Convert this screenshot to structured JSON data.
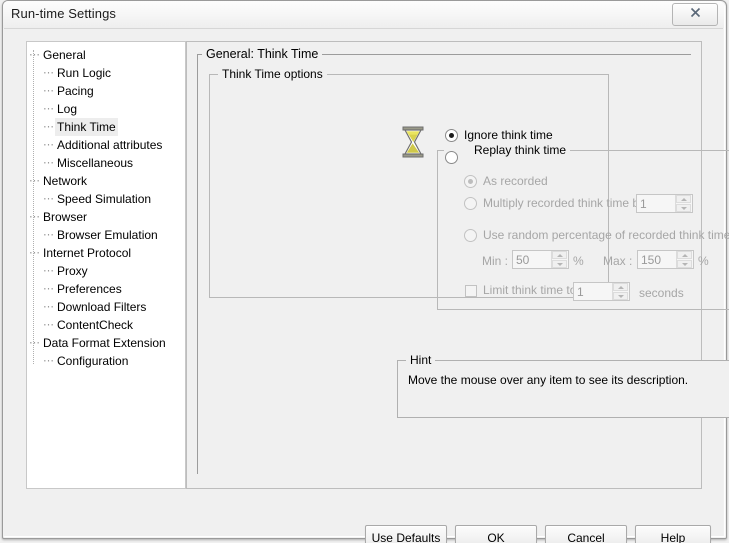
{
  "window": {
    "title": "Run-time Settings",
    "close_label": "✕",
    "close_icon": "close-icon"
  },
  "tree": {
    "items": [
      {
        "label": "General",
        "level": 0,
        "selected": false
      },
      {
        "label": "Run Logic",
        "level": 1,
        "selected": false
      },
      {
        "label": "Pacing",
        "level": 1,
        "selected": false
      },
      {
        "label": "Log",
        "level": 1,
        "selected": false
      },
      {
        "label": "Think Time",
        "level": 1,
        "selected": true
      },
      {
        "label": "Additional attributes",
        "level": 1,
        "selected": false
      },
      {
        "label": "Miscellaneous",
        "level": 1,
        "selected": false
      },
      {
        "label": "Network",
        "level": 0,
        "selected": false
      },
      {
        "label": "Speed Simulation",
        "level": 1,
        "selected": false
      },
      {
        "label": "Browser",
        "level": 0,
        "selected": false
      },
      {
        "label": "Browser Emulation",
        "level": 1,
        "selected": false
      },
      {
        "label": "Internet Protocol",
        "level": 0,
        "selected": false
      },
      {
        "label": "Proxy",
        "level": 1,
        "selected": false
      },
      {
        "label": "Preferences",
        "level": 1,
        "selected": false
      },
      {
        "label": "Download Filters",
        "level": 1,
        "selected": false
      },
      {
        "label": "ContentCheck",
        "level": 1,
        "selected": false
      },
      {
        "label": "Data Format Extension",
        "level": 0,
        "selected": false
      },
      {
        "label": "Configuration",
        "level": 1,
        "selected": false
      }
    ]
  },
  "content": {
    "heading": "General: Think Time",
    "think_time_options": {
      "legend": "Think Time options",
      "icon": "hourglass-icon",
      "ignore_think_time": {
        "label": "Ignore think time",
        "checked": true,
        "enabled": true
      },
      "replay_think_time": {
        "label": "Replay think time",
        "checked": false,
        "enabled": true,
        "as_recorded": {
          "label": "As recorded",
          "checked": true,
          "enabled": false
        },
        "multiply": {
          "label": "Multiply recorded think time by:",
          "checked": false,
          "enabled": false,
          "value": "1"
        },
        "random_percentage": {
          "label": "Use random percentage of recorded think time",
          "checked": false,
          "enabled": false,
          "min_label": "Min :",
          "min_value": "50",
          "min_unit": "%",
          "max_label": "Max :",
          "max_value": "150",
          "max_unit": "%"
        },
        "limit": {
          "label": "Limit think time to:",
          "checked": false,
          "enabled": false,
          "value": "1",
          "unit": "seconds"
        }
      }
    },
    "hint": {
      "legend": "Hint",
      "text": "Move the mouse over any item to see its description."
    }
  },
  "buttons": {
    "use_defaults": "Use Defaults",
    "ok": "OK",
    "cancel": "Cancel",
    "help": "Help"
  },
  "colors": {
    "dialog_bg": "#f0f0f0",
    "panel_bg": "#ffffff",
    "border": "#b8b8b8",
    "disabled_text": "#a6a6a6",
    "hourglass_sand": "#d9d24a",
    "hourglass_frame": "#808080"
  }
}
